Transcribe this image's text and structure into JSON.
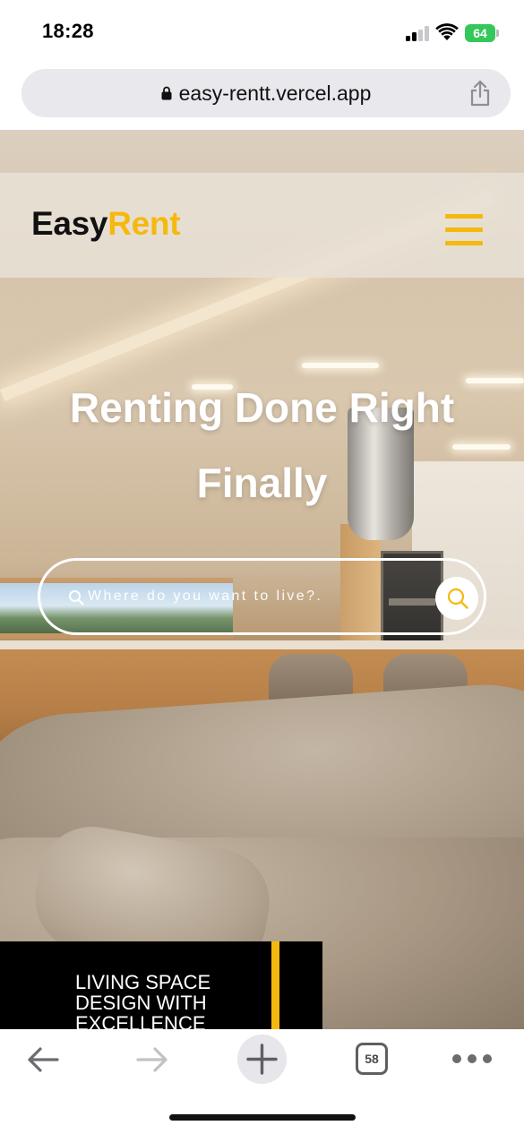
{
  "status_bar": {
    "time": "18:28",
    "battery_level": "64",
    "battery_color": "#34c759",
    "icons": [
      "signal-icon",
      "wifi-icon",
      "battery-icon"
    ]
  },
  "browser": {
    "url": "easy-rentt.vercel.app",
    "secure": true,
    "icons": [
      "lock-icon",
      "share-icon"
    ]
  },
  "site": {
    "brand_part1": "Easy",
    "brand_part2": "Rent",
    "brand_colors": {
      "primary_text": "#111111",
      "accent": "#f5b90d"
    },
    "menu_icon": "hamburger-menu-icon"
  },
  "hero": {
    "title_line1": "Renting Done Right",
    "title_line2": "Finally",
    "search_placeholder": "Where do you want to live?.",
    "search_icons": [
      "search-icon",
      "search-submit-icon"
    ]
  },
  "promo": {
    "text_line1": "LIVING SPACE",
    "text_line2": "DESIGN WITH",
    "text_line3": "EXCELLENCE"
  },
  "toolbar": {
    "tab_count": "58",
    "icons": [
      "back-arrow-icon",
      "forward-arrow-icon",
      "new-tab-plus-icon",
      "tabs-icon",
      "more-options-icon"
    ]
  }
}
